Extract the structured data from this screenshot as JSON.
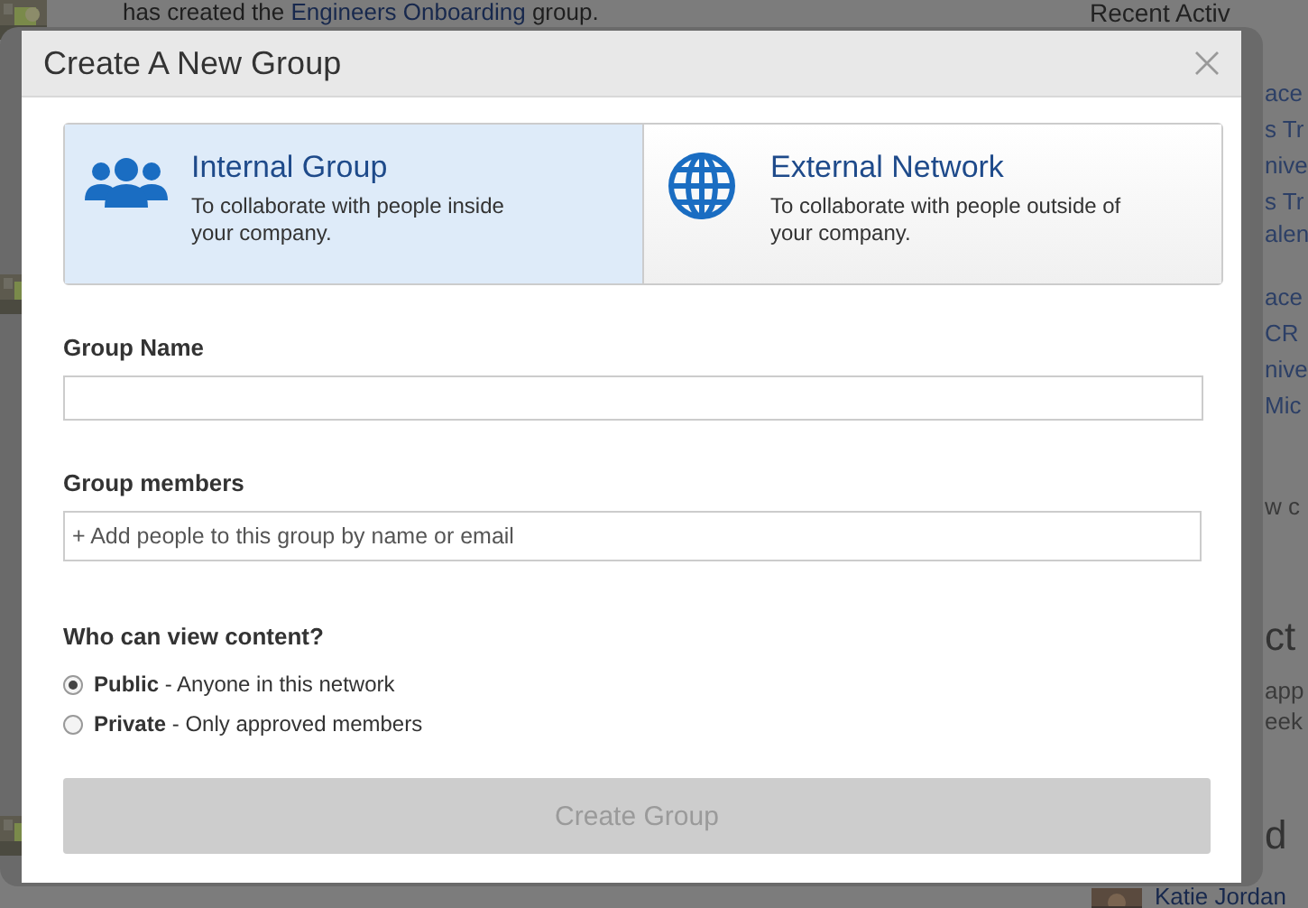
{
  "background": {
    "feed": {
      "before": "has created the ",
      "link": "Engineers Onboarding",
      "after": " group."
    },
    "heading": "Recent Activ",
    "fragments": [
      {
        "text": "ace",
        "kind": "link"
      },
      {
        "text": "s Tr",
        "kind": "link"
      },
      {
        "text": "nive",
        "kind": "link"
      },
      {
        "text": "s Tr",
        "kind": "link"
      },
      {
        "text": "alen",
        "kind": "link"
      },
      {
        "text": "ace",
        "kind": "link"
      },
      {
        "text": "CR",
        "kind": "link"
      },
      {
        "text": "nive",
        "kind": "link"
      },
      {
        "text": "Mic",
        "kind": "link"
      },
      {
        "text": "w c",
        "kind": "plain"
      },
      {
        "text": "ct",
        "kind": "heading"
      },
      {
        "text": "app",
        "kind": "plain"
      },
      {
        "text": "eek",
        "kind": "plain"
      },
      {
        "text": "d",
        "kind": "heading"
      }
    ],
    "person": "Katie Jordan"
  },
  "dialog": {
    "title": "Create A New Group",
    "options": [
      {
        "kind": "people",
        "title": "Internal Group",
        "description": "To collaborate with people inside your company.",
        "selected": true
      },
      {
        "kind": "globe",
        "title": "External Network",
        "description": "To collaborate with people outside of your company.",
        "selected": false
      }
    ],
    "group_name": {
      "label": "Group Name"
    },
    "members": {
      "label": "Group members",
      "placeholder": "+ Add people to this group by name or email"
    },
    "visibility": {
      "question": "Who can view content?",
      "choices": [
        {
          "label": "**Public** - Anyone in this network",
          "selected": true
        },
        {
          "label": "**Private** - Only approved members",
          "selected": false
        }
      ]
    },
    "submit": {
      "label": "Create Group",
      "disabled": true
    }
  }
}
